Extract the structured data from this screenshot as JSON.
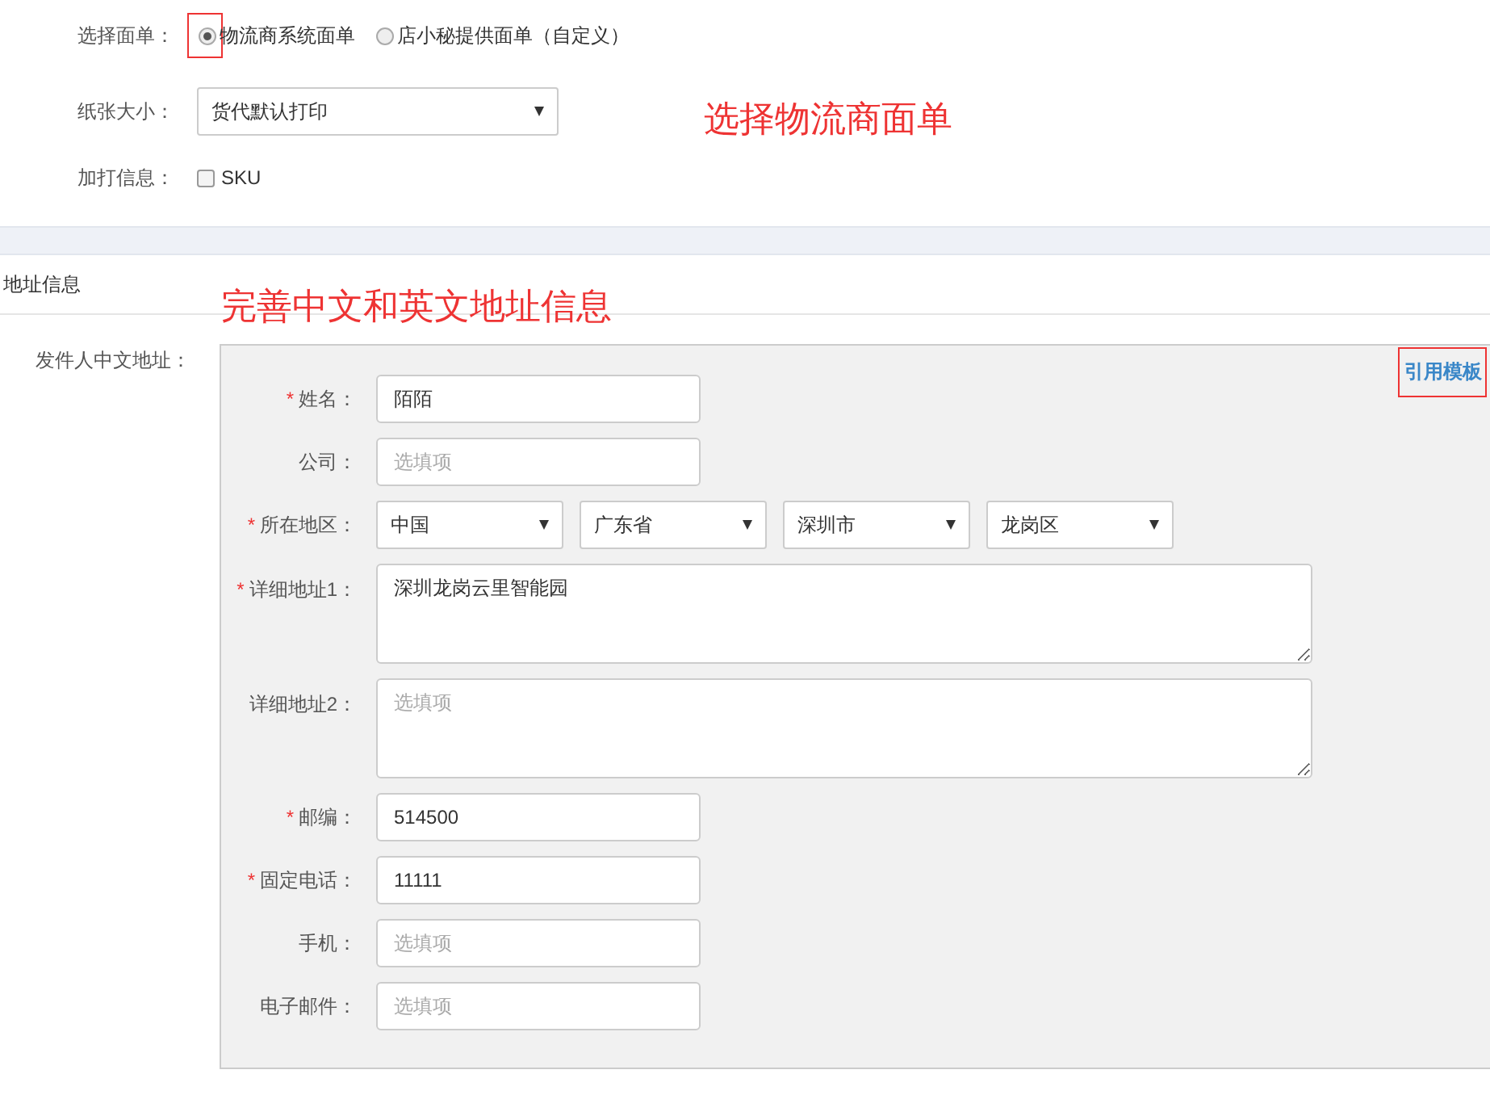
{
  "paper_form": {
    "label": "选择面单：",
    "options": [
      {
        "label": "物流商系统面单",
        "selected": true,
        "highlighted": true
      },
      {
        "label": "店小秘提供面单（自定义）",
        "selected": false,
        "highlighted": false
      }
    ]
  },
  "paper_size": {
    "label": "纸张大小：",
    "value": "货代默认打印"
  },
  "extra_info": {
    "label": "加打信息：",
    "options": [
      {
        "label": "SKU",
        "checked": false
      }
    ]
  },
  "annotations": [
    "选择物流商面单",
    "完善中文和英文地址信息"
  ],
  "address_section": {
    "title": "地址信息",
    "sender_label": "发件人中文地址：",
    "template_link": "引用模板",
    "fields": [
      {
        "kind": "input",
        "label": "姓名：",
        "required_mark": "*",
        "value": "陌陌"
      },
      {
        "kind": "input",
        "label": "公司：",
        "placeholder": "选填项"
      },
      {
        "kind": "selects",
        "label": "所在地区：",
        "required_mark": "*",
        "values": [
          "中国",
          "广东省",
          "深圳市",
          "龙岗区"
        ]
      },
      {
        "kind": "textarea",
        "label": "详细地址1：",
        "required_mark": "*",
        "value": "深圳龙岗云里智能园"
      },
      {
        "kind": "textarea",
        "label": "详细地址2：",
        "placeholder": "选填项"
      },
      {
        "kind": "input",
        "label": "邮编：",
        "required_mark": "*",
        "value": "514500"
      },
      {
        "kind": "input",
        "label": "固定电话：",
        "required_mark": "*",
        "value": "11111"
      },
      {
        "kind": "input",
        "label": "手机：",
        "placeholder": "选填项"
      },
      {
        "kind": "input",
        "label": "电子邮件：",
        "placeholder": "选填项"
      }
    ]
  }
}
